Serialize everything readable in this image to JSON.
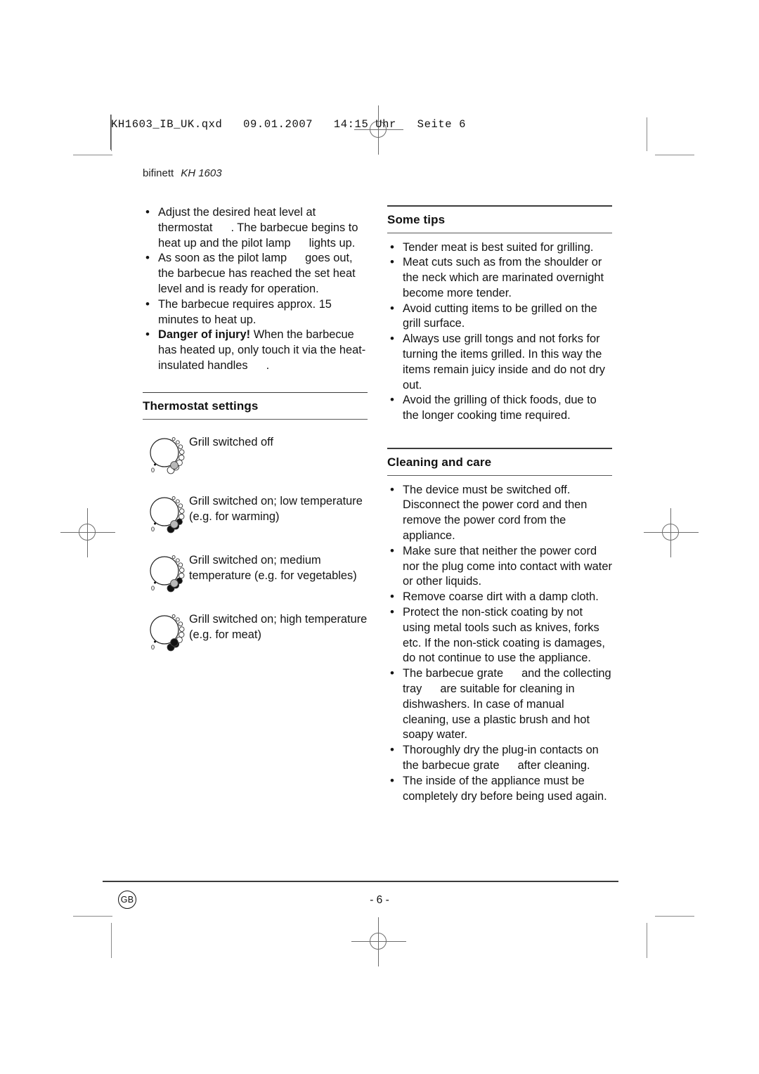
{
  "page": {
    "file_info": "KH1603_IB_UK.qxd   09.01.2007   14:15 Uhr   Seite 6",
    "running_head_brand": "bifinett",
    "running_head_model": "KH 1603",
    "page_number": "- 6 -",
    "locale_badge": "GB"
  },
  "left_column": {
    "intro_bullets": [
      {
        "parts": [
          {
            "type": "text",
            "value": "Adjust the desired heat level at thermostat"
          },
          {
            "type": "gap"
          },
          {
            "type": "text",
            "value": ". The barbecue begins to heat up and the pilot lamp"
          },
          {
            "type": "gap"
          },
          {
            "type": "text",
            "value": "lights up."
          }
        ]
      },
      {
        "parts": [
          {
            "type": "text",
            "value": "As soon as the pilot lamp"
          },
          {
            "type": "gap"
          },
          {
            "type": "text",
            "value": "goes out, the barbecue has reached the set heat level and is ready for operation."
          }
        ]
      },
      {
        "parts": [
          {
            "type": "text",
            "value": "The barbecue requires approx. 15 minutes to heat up."
          }
        ]
      },
      {
        "parts": [
          {
            "type": "bold",
            "value": "Danger of injury!"
          },
          {
            "type": "text",
            "value": " When the barbecue has heated up, only touch it via the heat-insulated handles"
          },
          {
            "type": "gap"
          },
          {
            "type": "text",
            "value": "."
          }
        ]
      }
    ],
    "thermostat": {
      "heading": "Thermostat settings",
      "settings": [
        {
          "label": "Grill switched off",
          "dial_zero_label": "0",
          "filled_marks": 0,
          "knob": "grey"
        },
        {
          "label": "Grill switched on; low temperature (e.g. for warming)",
          "dial_zero_label": "0",
          "filled_marks": 3,
          "knob": "grey"
        },
        {
          "label": "Grill switched on; medium temperature (e.g. for vegetables)",
          "dial_zero_label": "0",
          "filled_marks": 3,
          "knob": "grey"
        },
        {
          "label": "Grill switched on; high temperature (e.g. for meat)",
          "dial_zero_label": "0",
          "filled_marks": 2,
          "knob": "black"
        }
      ]
    }
  },
  "right_column": {
    "some_tips": {
      "heading": "Some tips",
      "bullets": [
        "Tender meat is best suited for grilling.",
        "Meat cuts such as from the shoulder or the neck which are marinated overnight become more tender.",
        "Avoid cutting items to be grilled on the grill surface.",
        "Always use grill tongs and not forks for turning the items grilled. In this way the items remain juicy inside and do not dry out.",
        "Avoid the grilling of thick foods, due to the longer cooking time required."
      ]
    },
    "cleaning_and_care": {
      "heading": "Cleaning and care",
      "bullets": [
        {
          "parts": [
            {
              "type": "text",
              "value": "The device must be switched off. Disconnect the power cord and then remove the power cord from the appliance."
            }
          ]
        },
        {
          "parts": [
            {
              "type": "text",
              "value": "Make sure that neither the power cord nor the plug come into contact with water or other liquids."
            }
          ]
        },
        {
          "parts": [
            {
              "type": "text",
              "value": "Remove coarse dirt with a damp cloth."
            }
          ]
        },
        {
          "parts": [
            {
              "type": "text",
              "value": "Protect the non-stick coating by not using metal tools such as knives, forks etc. If the non-stick coating is damages, do not continue to use the appliance."
            }
          ]
        },
        {
          "parts": [
            {
              "type": "text",
              "value": "The barbecue grate"
            },
            {
              "type": "gap"
            },
            {
              "type": "text",
              "value": "and the collecting tray"
            },
            {
              "type": "gap"
            },
            {
              "type": "text",
              "value": "are suitable for cleaning in dishwashers. In case of manual cleaning, use a plastic brush and hot soapy water."
            }
          ]
        },
        {
          "parts": [
            {
              "type": "text",
              "value": "Thoroughly dry the plug-in contacts on the barbecue grate"
            },
            {
              "type": "gap"
            },
            {
              "type": "text",
              "value": "after cleaning."
            }
          ]
        },
        {
          "parts": [
            {
              "type": "text",
              "value": "The inside of the appliance must be completely dry before being used again."
            }
          ]
        }
      ]
    }
  }
}
